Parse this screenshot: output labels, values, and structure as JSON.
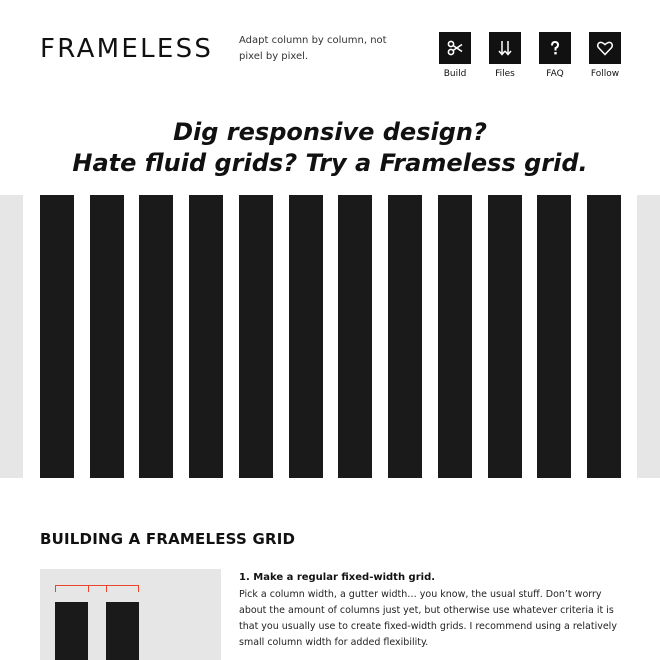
{
  "header": {
    "logo": "FRAMELESS",
    "tagline": "Adapt column by column, not pixel by pixel."
  },
  "nav": {
    "items": [
      {
        "label": "Build",
        "icon": "scissors-icon"
      },
      {
        "label": "Files",
        "icon": "download-arrows-icon"
      },
      {
        "label": "FAQ",
        "icon": "question-mark-icon"
      },
      {
        "label": "Follow",
        "icon": "heart-icon"
      }
    ]
  },
  "hero": {
    "line1": "Dig responsive design?",
    "line2": "Hate fluid grids? Try a Frameless grid."
  },
  "section": {
    "title": "BUILDING A FRAMELESS GRID",
    "step1": {
      "title": "1. Make a regular fixed-width grid.",
      "body": "Pick a column width, a gutter width… you know, the usual stuff. Don’t worry about the amount of columns just yet, but otherwise use whatever criteria it is that you usually use to create fixed-width grids. I recommend using a relatively small column width for added flexibility."
    }
  },
  "colors": {
    "column": "#1a1a1a",
    "edge_gutter": "#e6e6e6",
    "accent": "#e8452c"
  }
}
